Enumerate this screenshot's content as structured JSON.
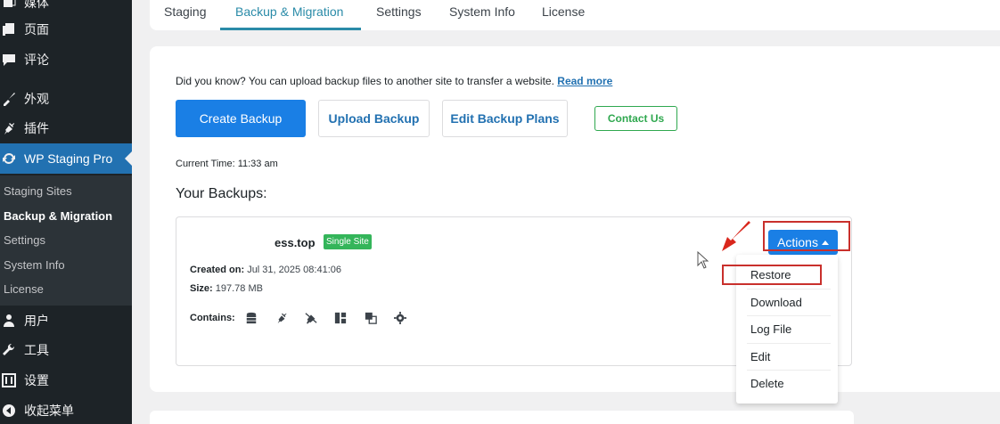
{
  "sidebar": {
    "menu": [
      {
        "label": "媒体",
        "icon": "media-icon"
      },
      {
        "label": "页面",
        "icon": "pages-icon"
      },
      {
        "label": "评论",
        "icon": "comments-icon"
      },
      {
        "label": "外观",
        "icon": "appearance-icon"
      },
      {
        "label": "插件",
        "icon": "plugins-icon"
      },
      {
        "label": "WP Staging Pro",
        "icon": "sync-icon"
      },
      {
        "label": "用户",
        "icon": "users-icon"
      },
      {
        "label": "工具",
        "icon": "tools-icon"
      },
      {
        "label": "设置",
        "icon": "settings-icon"
      },
      {
        "label": "收起菜单",
        "icon": "collapse-icon"
      }
    ],
    "submenu": [
      "Staging Sites",
      "Backup & Migration",
      "Settings",
      "System Info",
      "License"
    ]
  },
  "tabs": [
    "Staging",
    "Backup & Migration",
    "Settings",
    "System Info",
    "License"
  ],
  "main": {
    "tip_text": "Did you know? You can upload backup files to another site to transfer a website.",
    "tip_link": "Read more",
    "buttons": {
      "create": "Create Backup",
      "upload": "Upload Backup",
      "edit_plans": "Edit Backup Plans",
      "contact": "Contact Us"
    },
    "current_time_label": "Current Time:",
    "current_time_value": "11:33 am",
    "your_backups": "Your Backups:"
  },
  "backup": {
    "site": "ess.top",
    "badge": "Single Site",
    "created_label": "Created on:",
    "created_value": "Jul 31, 2025 08:41:06",
    "size_label": "Size:",
    "size_value": "197.78 MB",
    "contains_label": "Contains:",
    "contains_icons": [
      "database-icon",
      "plugins-icon",
      "mu-plugins-icon",
      "themes-icon",
      "media-icon",
      "settings-icon"
    ]
  },
  "actions": {
    "label": "Actions",
    "items": [
      "Restore",
      "Download",
      "Log File",
      "Edit",
      "Delete"
    ]
  },
  "colors": {
    "sidebar_bg": "#1d2327",
    "active_menu": "#2271b1",
    "primary_button": "#1a7fe5",
    "accent_tab": "#2a8ba8",
    "badge_green": "#34b55a",
    "annotation_red": "#c9302c"
  }
}
